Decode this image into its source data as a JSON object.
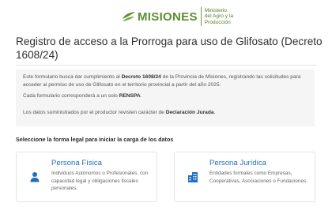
{
  "header": {
    "logo_text": "MISIONES",
    "logo_sub_line1": "Ministerio",
    "logo_sub_line2": "del Agro y la",
    "logo_sub_line3": "Producción"
  },
  "page": {
    "title": "Registro de acceso a la Prorroga para uso de Glifosato (Decreto 1608/24)"
  },
  "info": {
    "p1_a": "Este formulario busca dar cumplimiento al ",
    "p1_b": "Decreto 1608/24",
    "p1_c": " de la Provincia de Misiones, registrando las solicitudes para acceder al permiso de uso de Glifosato en el territorio provincial a partir del año 2025.",
    "p2_a": "Cada formulario corresponderá a un solo ",
    "p2_b": "RENSPA",
    "p2_c": ".",
    "p3_a": "Los datos suministrados por el productor revisten carácter de ",
    "p3_b": "Declaración Jurada",
    "p3_c": "."
  },
  "section": {
    "label": "Seleccione la forma legal para iniciar la carga de los datos"
  },
  "cards": [
    {
      "title": "Persona Física",
      "description": "Individuos Autónomos o Profesionales, con capacidad legal y obligaciones fiscales personales.",
      "icon": "person-icon"
    },
    {
      "title": "Persona Jurídica",
      "description": "Entidades formales como Empresas, Cooperativas, Asociaciones o Fundaciones.",
      "icon": "building-icon"
    }
  ],
  "colors": {
    "brand_green": "#5a8f2e",
    "accent_blue": "#1f6fc1",
    "info_bg": "#f5f5f5"
  }
}
